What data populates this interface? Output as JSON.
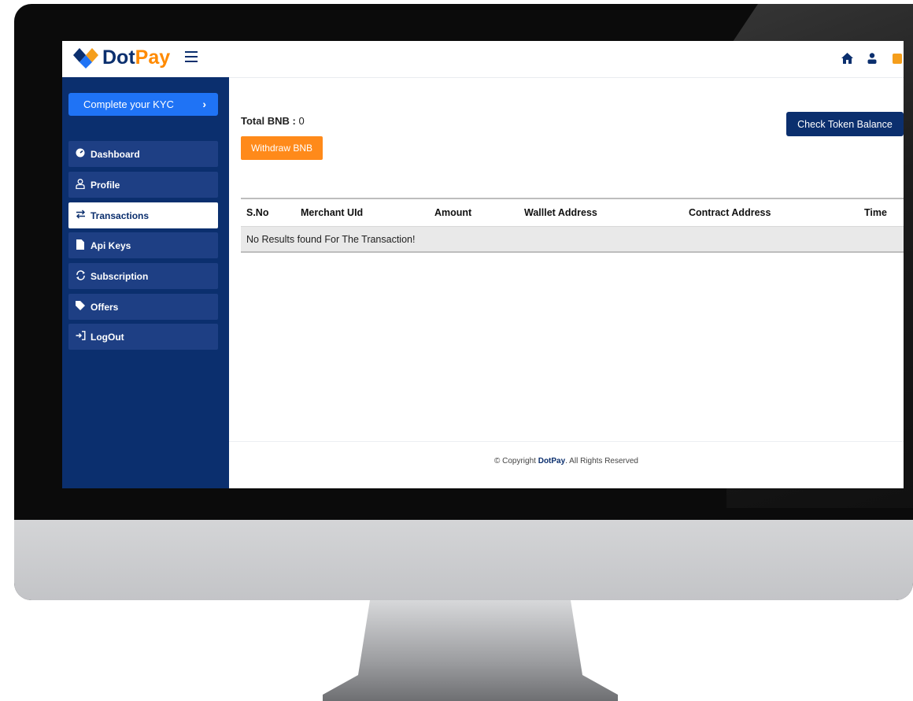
{
  "brand": {
    "name_primary": "Dot",
    "name_accent": "Pay"
  },
  "header_icons": [
    "home-icon",
    "user-icon",
    "wallet-icon"
  ],
  "kyc_button": {
    "label": "Complete your KYC",
    "chevron": "›"
  },
  "sidebar": {
    "items": [
      {
        "label": "Dashboard",
        "icon": "dashboard-icon",
        "active": false
      },
      {
        "label": "Profile",
        "icon": "profile-icon",
        "active": false
      },
      {
        "label": "Transactions",
        "icon": "transactions-icon",
        "active": true
      },
      {
        "label": "Api Keys",
        "icon": "file-icon",
        "active": false
      },
      {
        "label": "Subscription",
        "icon": "sync-icon",
        "active": false
      },
      {
        "label": "Offers",
        "icon": "tag-icon",
        "active": false
      },
      {
        "label": "LogOut",
        "icon": "logout-icon",
        "active": false
      }
    ]
  },
  "main": {
    "total_label": "Total BNB :",
    "total_value": "0",
    "withdraw_label": "Withdraw BNB",
    "check_balance_label": "Check Token Balance",
    "table": {
      "columns": [
        "S.No",
        "Merchant UId",
        "Amount",
        "Walllet Address",
        "Contract Address",
        "Time"
      ],
      "empty_message": "No Results found For The Transaction!"
    }
  },
  "footer": {
    "prefix": "© Copyright ",
    "brand": "DotPay",
    "suffix": ". All Rights Reserved"
  },
  "colors": {
    "navy": "#0b2f6e",
    "orange": "#ff8a1a",
    "blue": "#1f73f5"
  }
}
